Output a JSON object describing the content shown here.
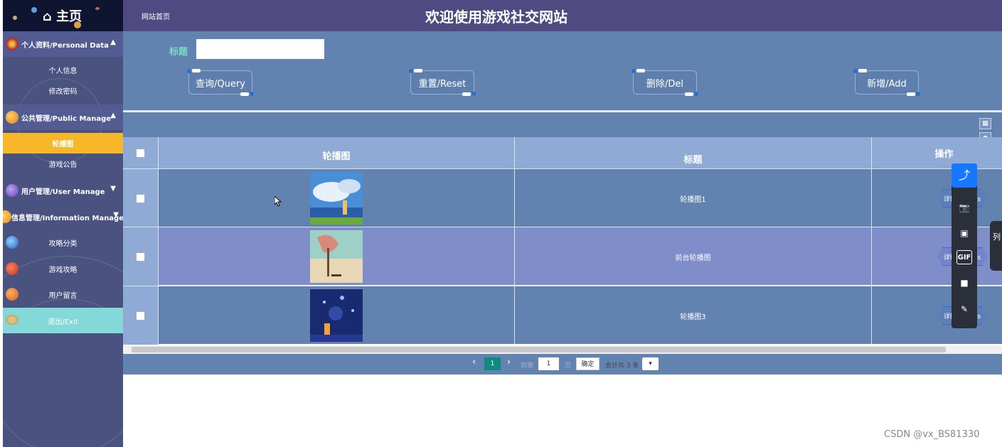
{
  "sidebar": {
    "home_label": "⌂ 主页",
    "groups": [
      {
        "label": "个人资料/Personal Data",
        "items": [
          "个人信息",
          "修改密码"
        ]
      },
      {
        "label": "公共管理/Public Manage",
        "items": [
          "轮播图",
          "游戏公告"
        ]
      },
      {
        "label": "用户管理/User Manage",
        "items": []
      },
      {
        "label": "信息管理/Information Manage",
        "items": [
          "攻略分类",
          "游戏攻略",
          "用户留言"
        ]
      }
    ],
    "exit_label": "退出/Exit",
    "active_item": "轮播图"
  },
  "header": {
    "breadcrumb": "网站首页",
    "title": "欢迎使用游戏社交网站"
  },
  "search": {
    "label": "标题",
    "value": ""
  },
  "actions": {
    "query": "查询/Query",
    "reset": "重置/Reset",
    "delete": "删除/Del",
    "add": "新增/Add"
  },
  "table": {
    "columns": [
      "轮播图",
      "标题",
      "操作"
    ],
    "rows": [
      {
        "title": "轮播图1",
        "action": "详情/Details"
      },
      {
        "title": "前台轮播图",
        "action": "详情/Details"
      },
      {
        "title": "轮播图3",
        "action": "详情/Details"
      }
    ]
  },
  "pager": {
    "current_page": "1",
    "goto_prefix": "到第",
    "goto_value": "1",
    "goto_suffix": "页",
    "confirm": "确定",
    "total": "合计共 3 条"
  },
  "float_toolbar": {
    "gif_label": "GIF",
    "side_tab": "列"
  },
  "watermark": "CSDN @vx_BS81330"
}
